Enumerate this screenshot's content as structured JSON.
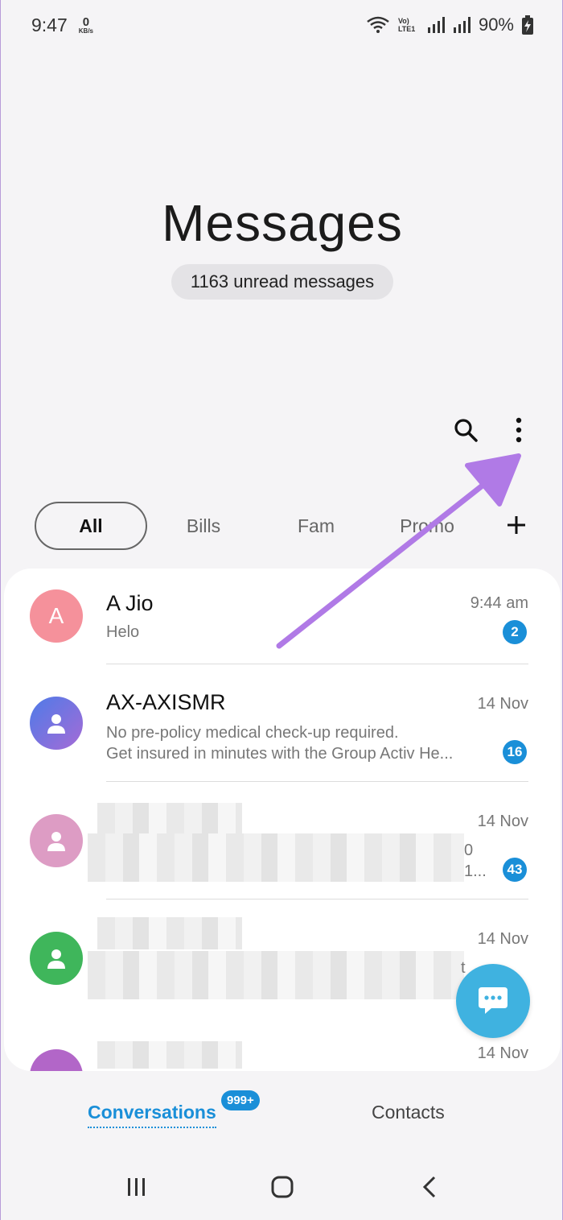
{
  "status_bar": {
    "time": "9:47",
    "net_speed_value": "0",
    "net_speed_unit": "KB/s",
    "carrier_label": "Vo) LTE1",
    "battery_percent": "90%"
  },
  "header": {
    "title": "Messages",
    "unread_pill": "1163 unread messages"
  },
  "toolbar": {
    "search_icon": "search-icon",
    "more_icon": "more-vert-icon"
  },
  "tabs": [
    {
      "label": "All",
      "active": true
    },
    {
      "label": "Bills",
      "active": false
    },
    {
      "label": "Fam",
      "active": false
    },
    {
      "label": "Promo",
      "active": false
    }
  ],
  "conversations": [
    {
      "avatar_letter": "A",
      "avatar_color": "#f5919b",
      "name": "A Jio",
      "preview": "Helo",
      "time": "9:44 am",
      "unread": "2"
    },
    {
      "avatar_color": "#7a6fe0",
      "name": "AX-AXISMR",
      "preview_line1": "No pre-policy medical check-up required.",
      "preview_line2": "Get insured in minutes with the Group Activ He...",
      "time": "14 Nov",
      "unread": "16"
    },
    {
      "avatar_color": "#dd9cc4",
      "time": "14 Nov",
      "preview_tail1": "0",
      "preview_tail2": "1...",
      "unread": "43"
    },
    {
      "avatar_color": "#3fb65b",
      "time": "14 Nov",
      "preview_tail1": "t"
    },
    {
      "avatar_color": "#b266c8",
      "time": "14 Nov"
    }
  ],
  "bottom_tabs": {
    "conversations_label": "Conversations",
    "conversations_badge": "999+",
    "contacts_label": "Contacts"
  },
  "colors": {
    "accent": "#1a8fd8",
    "fab": "#3fb2e0",
    "arrow": "#b07ae6"
  }
}
